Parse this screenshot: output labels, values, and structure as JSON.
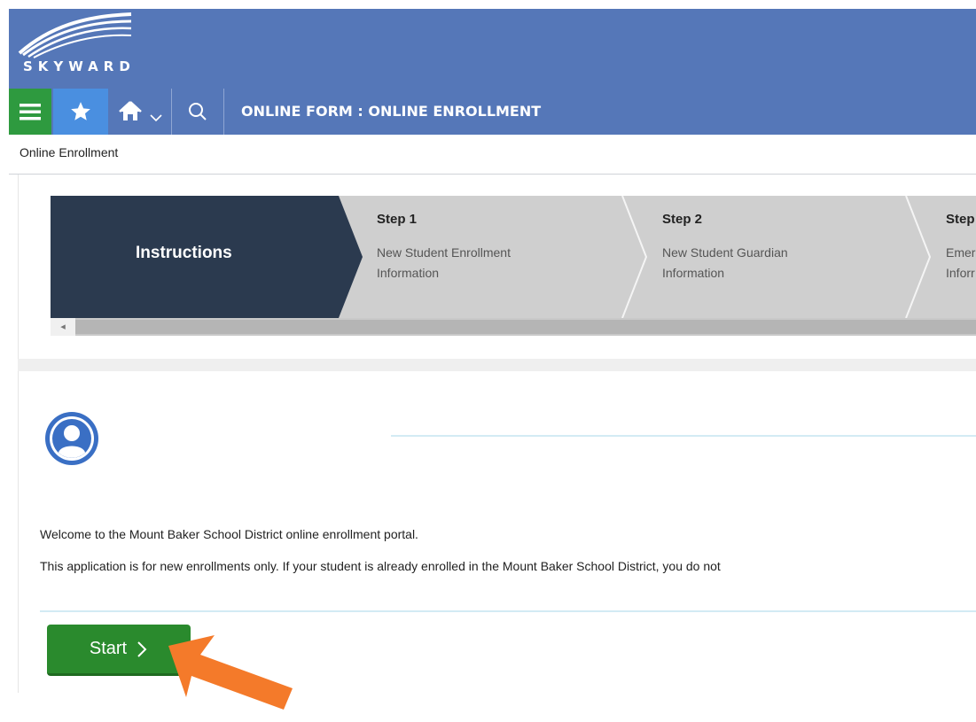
{
  "app": {
    "logo_text": "SKYWARD",
    "page_heading": "ONLINE FORM : ONLINE ENROLLMENT",
    "breadcrumb": "Online Enrollment"
  },
  "nav": {
    "menu_icon": "hamburger-icon",
    "favorites_icon": "star-icon",
    "home_icon": "home-icon",
    "home_dropdown_icon": "chevron-down-icon",
    "search_icon": "search-icon"
  },
  "wizard": {
    "steps": [
      {
        "title": "Instructions",
        "subtitle": ""
      },
      {
        "title": "Step 1",
        "subtitle_line1": "New Student Enrollment",
        "subtitle_line2": "Information"
      },
      {
        "title": "Step 2",
        "subtitle_line1": "New Student Guardian",
        "subtitle_line2": "Information"
      },
      {
        "title": "Step",
        "subtitle_line1": "Emer",
        "subtitle_line2": "Inforr"
      }
    ],
    "active_step": 0
  },
  "main": {
    "welcome": "Welcome to the Mount Baker School District online enrollment portal.",
    "info": "This application is for new enrollments only.  If your student is already enrolled in the Mount Baker School District, you do not",
    "start_label": "Start",
    "start_chevron": "›"
  },
  "colors": {
    "header_blue": "#5577b8",
    "menu_green": "#2e9a3f",
    "fav_blue": "#4a8fe0",
    "active_step": "#2b3a4f",
    "start_green": "#2a8a2d",
    "annotation_orange": "#f47a2a"
  }
}
